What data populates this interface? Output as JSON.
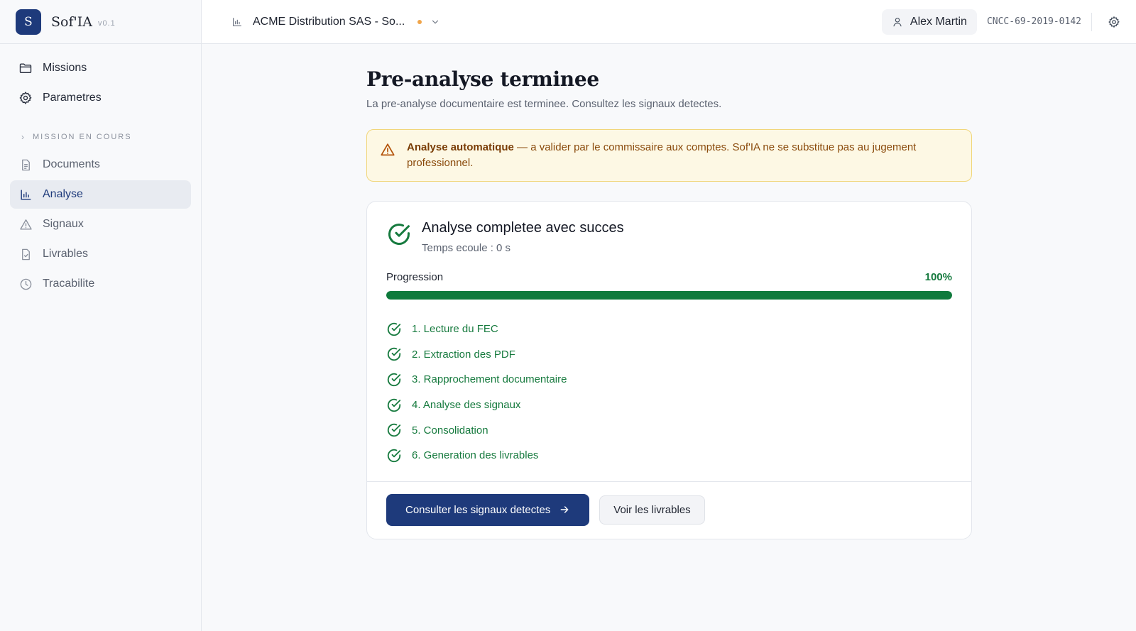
{
  "brand": {
    "logo_letter": "S",
    "name": "Sof'IA",
    "version": "v0.1"
  },
  "sidebar": {
    "primary": [
      {
        "label": "Missions",
        "icon": "folder-icon"
      },
      {
        "label": "Parametres",
        "icon": "gear-icon"
      }
    ],
    "section_label": "MISSION EN COURS",
    "mission_items": [
      {
        "label": "Documents",
        "icon": "document-icon",
        "active": false
      },
      {
        "label": "Analyse",
        "icon": "bar-chart-icon",
        "active": true
      },
      {
        "label": "Signaux",
        "icon": "warning-icon",
        "active": false
      },
      {
        "label": "Livrables",
        "icon": "file-check-icon",
        "active": false
      },
      {
        "label": "Tracabilite",
        "icon": "clock-icon",
        "active": false
      }
    ]
  },
  "header": {
    "mission_name": "ACME Distribution SAS - So...",
    "user_name": "Alex Martin",
    "license": "CNCC-69-2019-0142"
  },
  "main": {
    "title": "Pre-analyse terminee",
    "subtitle": "La pre-analyse documentaire est terminee. Consultez les signaux detectes.",
    "alert": {
      "strong": "Analyse automatique",
      "text": " — a valider par le commissaire aux comptes. Sof'IA ne se substitue pas au jugement professionnel."
    },
    "card": {
      "title": "Analyse completee avec succes",
      "elapsed": "Temps ecoule : 0 s",
      "progress_label": "Progression",
      "progress_value": "100%",
      "progress_fraction": 1.0,
      "steps": [
        "1. Lecture du FEC",
        "2. Extraction des PDF",
        "3. Rapprochement documentaire",
        "4. Analyse des signaux",
        "5. Consolidation",
        "6. Generation des livrables"
      ],
      "primary_button": "Consulter les signaux detectes",
      "secondary_button": "Voir les livrables"
    }
  },
  "colors": {
    "brand": "#1e3a7b",
    "success": "#167a3e",
    "warning_bg": "#fdf8e4",
    "warning_text": "#8a4a0b",
    "status_dot": "#f0a54a"
  }
}
